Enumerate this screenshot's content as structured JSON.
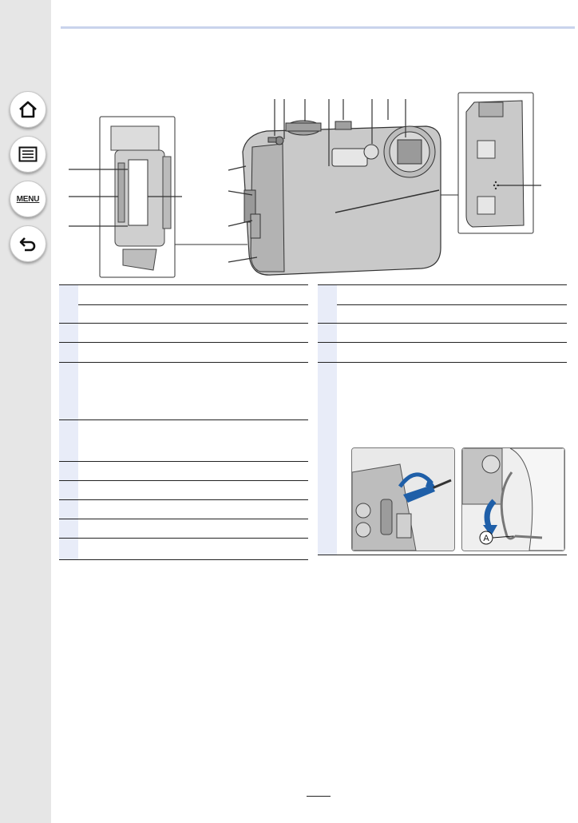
{
  "navigation": {
    "home_icon": "home-icon",
    "contents_icon": "list-icon",
    "menu_label": "MENU",
    "back_icon": "return-arrow-icon"
  },
  "colors": {
    "sidebar_bg": "#e6e6e6",
    "table_number_cell": "#e8ecf8",
    "header_rule": "#c9d3ec",
    "strap_arrow": "#1f5fa8"
  },
  "figure": {
    "callout_A": "A"
  },
  "page": {
    "number": ""
  }
}
